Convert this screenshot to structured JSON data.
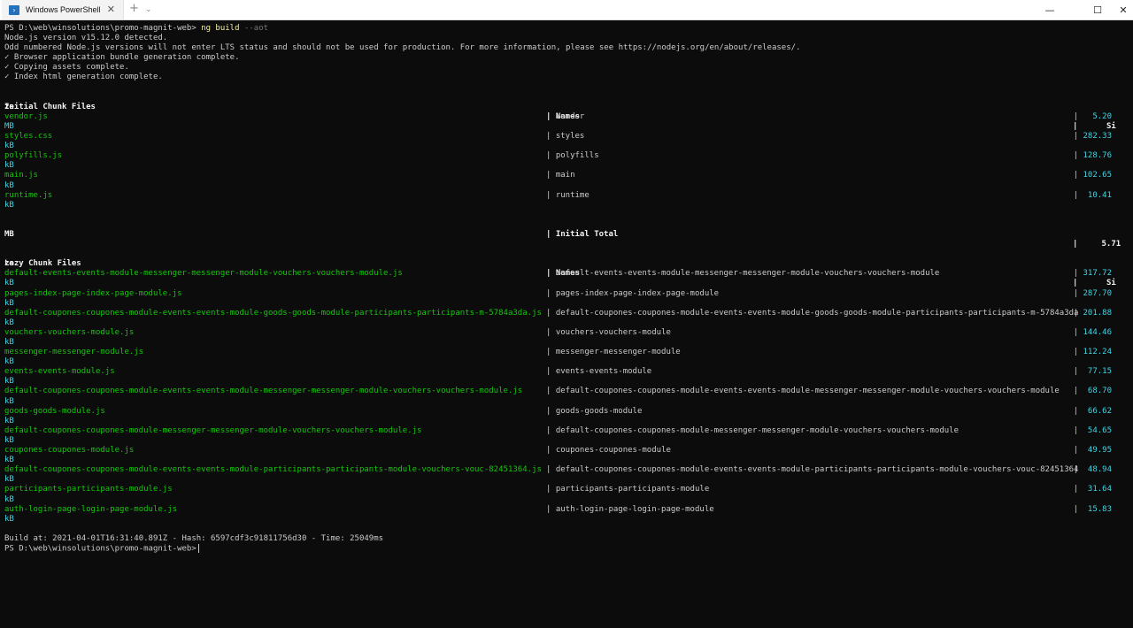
{
  "window": {
    "tab_title": "Windows PowerShell",
    "icon": "powershell-icon",
    "new_tab": "+",
    "dropdown": "⌄",
    "tab_close": "✕",
    "minimize": "—",
    "maximize": "☐",
    "close": "✕"
  },
  "terminal": {
    "prompt": "PS D:\\web\\winsolutions\\promo-magnit-web>",
    "command": "ng build",
    "command_flag": "--aot",
    "info_lines": [
      "Node.js version v15.12.0 detected.",
      "Odd numbered Node.js versions will not enter LTS status and should not be used for production. For more information, please see https://nodejs.org/en/about/releases/."
    ],
    "success_lines": [
      "✓ Browser application bundle generation complete.",
      "✓ Copying assets complete.",
      "✓ Index html generation complete."
    ],
    "sep": "|",
    "initial_header": {
      "files": "Initial Chunk Files",
      "names": "Names",
      "size": "Si",
      "size_wrap": "ze"
    },
    "initial_rows": [
      {
        "file": "vendor.js",
        "name": "vendor",
        "size": "5.20",
        "unit": "MB"
      },
      {
        "file": "styles.css",
        "name": "styles",
        "size": "282.33",
        "unit": "kB"
      },
      {
        "file": "polyfills.js",
        "name": "polyfills",
        "size": "128.76",
        "unit": "kB"
      },
      {
        "file": "main.js",
        "name": "main",
        "size": "102.65",
        "unit": "kB"
      },
      {
        "file": "runtime.js",
        "name": "runtime",
        "size": "10.41",
        "unit": "kB"
      }
    ],
    "initial_total": {
      "label": "Initial Total",
      "size": "5.71",
      "unit": "MB"
    },
    "lazy_header": {
      "files": "Lazy Chunk Files",
      "names": "Names",
      "size": "Si",
      "size_wrap": "ze"
    },
    "lazy_rows": [
      {
        "file": "default-events-events-module-messenger-messenger-module-vouchers-vouchers-module.js",
        "name": "default-events-events-module-messenger-messenger-module-vouchers-vouchers-module",
        "size": "317.72",
        "unit": "kB"
      },
      {
        "file": "pages-index-page-index-page-module.js",
        "name": "pages-index-page-index-page-module",
        "size": "287.70",
        "unit": "kB"
      },
      {
        "file": "default-coupones-coupones-module-events-events-module-goods-goods-module-participants-participants-m-5784a3da.js",
        "name": "default-coupones-coupones-module-events-events-module-goods-goods-module-participants-participants-m-5784a3da",
        "size": "201.88",
        "unit": "kB"
      },
      {
        "file": "vouchers-vouchers-module.js",
        "name": "vouchers-vouchers-module",
        "size": "144.46",
        "unit": "kB"
      },
      {
        "file": "messenger-messenger-module.js",
        "name": "messenger-messenger-module",
        "size": "112.24",
        "unit": "kB"
      },
      {
        "file": "events-events-module.js",
        "name": "events-events-module",
        "size": "77.15",
        "unit": "kB"
      },
      {
        "file": "default-coupones-coupones-module-events-events-module-messenger-messenger-module-vouchers-vouchers-module.js",
        "name": "default-coupones-coupones-module-events-events-module-messenger-messenger-module-vouchers-vouchers-module",
        "size": "68.70",
        "unit": "kB"
      },
      {
        "file": "goods-goods-module.js",
        "name": "goods-goods-module",
        "size": "66.62",
        "unit": "kB"
      },
      {
        "file": "default-coupones-coupones-module-messenger-messenger-module-vouchers-vouchers-module.js",
        "name": "default-coupones-coupones-module-messenger-messenger-module-vouchers-vouchers-module",
        "size": "54.65",
        "unit": "kB"
      },
      {
        "file": "coupones-coupones-module.js",
        "name": "coupones-coupones-module",
        "size": "49.95",
        "unit": "kB"
      },
      {
        "file": "default-coupones-coupones-module-events-events-module-participants-participants-module-vouchers-vouc-82451364.js",
        "name": "default-coupones-coupones-module-events-events-module-participants-participants-module-vouchers-vouc-82451364",
        "size": "48.94",
        "unit": "kB"
      },
      {
        "file": "participants-participants-module.js",
        "name": "participants-participants-module",
        "size": "31.64",
        "unit": "kB"
      },
      {
        "file": "auth-login-page-login-page-module.js",
        "name": "auth-login-page-login-page-module",
        "size": "15.83",
        "unit": "kB"
      }
    ],
    "build_summary": "Build at: 2021-04-01T16:31:40.891Z - Hash: 6597cdf3c91811756d30 - Time: 25049ms",
    "final_prompt": "PS D:\\web\\winsolutions\\promo-magnit-web>"
  },
  "colors": {
    "background": "#0c0c0c",
    "text": "#cccccc",
    "file_green": "#16c60c",
    "size_cyan": "#3ed6e6",
    "command_yellow": "#f9f1a5"
  }
}
